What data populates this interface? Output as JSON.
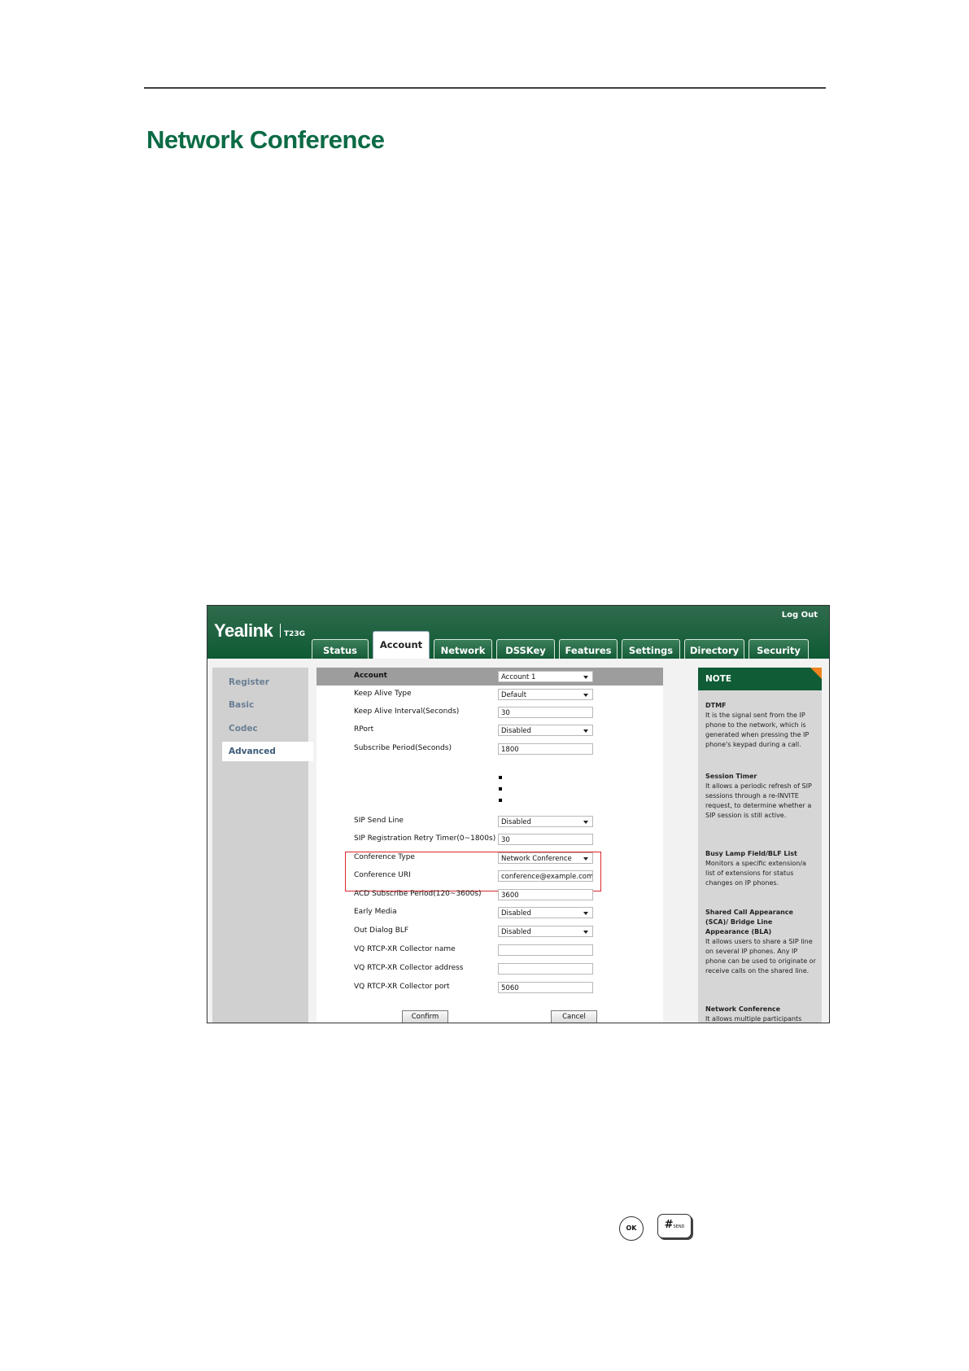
{
  "heading": "Network Conference",
  "screenshot": {
    "logout": "Log Out",
    "logo": "Yealink",
    "model": "T23G",
    "tabs": [
      "Status",
      "Account",
      "Network",
      "DSSKey",
      "Features",
      "Settings",
      "Directory",
      "Security"
    ],
    "active_tab": "Account",
    "sidebar": [
      "Register",
      "Basic",
      "Codec",
      "Advanced"
    ],
    "active_sidebar": "Advanced",
    "fields": {
      "account": {
        "label": "Account",
        "value": "Account 1"
      },
      "keep_alive_type": {
        "label": "Keep Alive Type",
        "value": "Default"
      },
      "keep_alive_interval": {
        "label": "Keep Alive Interval(Seconds)",
        "value": "30"
      },
      "rport": {
        "label": "RPort",
        "value": "Disabled"
      },
      "subscribe_period": {
        "label": "Subscribe Period(Seconds)",
        "value": "1800"
      },
      "sip_send_line": {
        "label": "SIP Send Line",
        "value": "Disabled"
      },
      "sip_reg_retry": {
        "label": "SIP Registration Retry Timer(0~1800s)",
        "value": "30"
      },
      "conference_type": {
        "label": "Conference Type",
        "value": "Network Conference"
      },
      "conference_uri": {
        "label": "Conference URI",
        "value": "conference@example.com"
      },
      "acd_subscribe": {
        "label": "ACD Subscribe Period(120~3600s)",
        "value": "3600"
      },
      "early_media": {
        "label": "Early Media",
        "value": "Disabled"
      },
      "out_dialog_blf": {
        "label": "Out Dialog BLF",
        "value": "Disabled"
      },
      "vq_name": {
        "label": "VQ RTCP-XR Collector name",
        "value": ""
      },
      "vq_address": {
        "label": "VQ RTCP-XR Collector address",
        "value": ""
      },
      "vq_port": {
        "label": "VQ RTCP-XR Collector port",
        "value": "5060"
      }
    },
    "buttons": {
      "confirm": "Confirm",
      "cancel": "Cancel"
    },
    "note": {
      "title": "NOTE",
      "sections": [
        {
          "title": "DTMF",
          "text": "It is the signal sent from the IP phone to the network, which is generated when pressing the IP phone's keypad during a call."
        },
        {
          "title": "Session Timer",
          "text": "It allows a periodic refresh of SIP sessions through a re-INVITE request, to determine whether a SIP session is still active."
        },
        {
          "title": "Busy Lamp Field/BLF List",
          "text": "Monitors a specific extension/a list of extensions for status changes on IP phones."
        },
        {
          "title": "Shared Call Appearance (SCA)/ Bridge Line Appearance (BLA)",
          "text": "It allows users to share a SIP line on several IP phones. Any IP phone can be used to originate or receive calls on the shared line."
        },
        {
          "title": "Network Conference",
          "text": "It allows multiple participants"
        }
      ]
    }
  },
  "keys": {
    "ok": "OK",
    "hash": "#",
    "hash_sub": "SEND"
  },
  "colors": {
    "heading": "#0c6b45",
    "yealink_green": "#0f5c36",
    "highlight": "#d7272c",
    "note_corner": "#f08420"
  }
}
